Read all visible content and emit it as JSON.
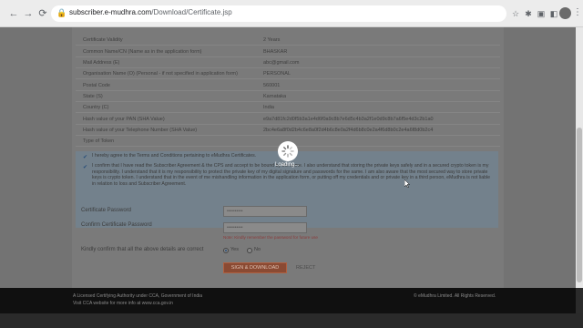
{
  "browser": {
    "url_host": "subscriber.e-mudhra.com",
    "url_path": "/Download/Certificate.jsp",
    "back": "←",
    "forward": "→",
    "reload": "⟳"
  },
  "details": [
    {
      "label": "Certificate Validity",
      "value": "2 Years"
    },
    {
      "label": "Common Name/CN (Name as in the application form)",
      "value": "BHASKAR"
    },
    {
      "label": "Mail Address (E)",
      "value": "abc@gmail.com"
    },
    {
      "label": "Organisation Name (O) (Personal - if not specified in application form)",
      "value": "PERSONAL"
    },
    {
      "label": "Postal Code",
      "value": "560001"
    },
    {
      "label": "State (S)",
      "value": "Karnataka"
    },
    {
      "label": "Country (C)",
      "value": "India"
    },
    {
      "label": "Hash value of your PAN (SHA Value)",
      "value": "e9a7d81fc2d0f5b3a1e4d6f0a9c8b7e6d5c4b3a2f1e0d9c8b7a6f5e4d3c2b1a0"
    },
    {
      "label": "Hash value of your Telephone Number (SHA Value)",
      "value": "2bc4e6a8f0d2b4c6e8a0f2d4b6c8e0a2f4d6b8c0e2a4f6d8b0c2e4a6f8d0b2c4"
    },
    {
      "label": "Type of Token",
      "value": ""
    }
  ],
  "acknowledgements": [
    "I hereby agree to the Terms and Conditions pertaining to eMudhra Certificates.",
    "I confirm that I have read the Subscriber Agreement & the CPS and accept to be bound by the same. I also understand that storing the private keys safely and in a secured crypto token is my responsibility. I understand that it is my responsibility to protect the private key of my digital signature and passwords for the same. I am also aware that the most secured way to store private keys is crypto token. I understand that in the event of me mishandling information in the application form, or putting off my credentials and or private key in a third person, eMudhra is not liable in relation to loss and Subscriber Agreement."
  ],
  "form": {
    "cert_password_label": "Certificate Password",
    "cert_password_value": "••••••••••",
    "confirm_password_label": "Confirm Certificate Password",
    "confirm_password_value": "••••••••••",
    "hint": "Note: Kindly remember the password for future use",
    "confirm_question": "Kindly confirm that all the above details are correct",
    "yes_label": "Yes",
    "no_label": "No",
    "sign_button": "SIGN & DOWNLOAD",
    "reject_button": "REJECT"
  },
  "footer": {
    "line1": "A Licensed Certifying Authority under CCA, Government of India",
    "line2": "Visit CCA website for more info at www.cca.gov.in",
    "right": "© eMudhra Limited. All Rights Reserved."
  },
  "overlay": {
    "loading_text": "Loading..."
  },
  "colors": {
    "page_dim": "#737373",
    "primary_button": "#8a4a33",
    "footer_bg": "#101010"
  }
}
